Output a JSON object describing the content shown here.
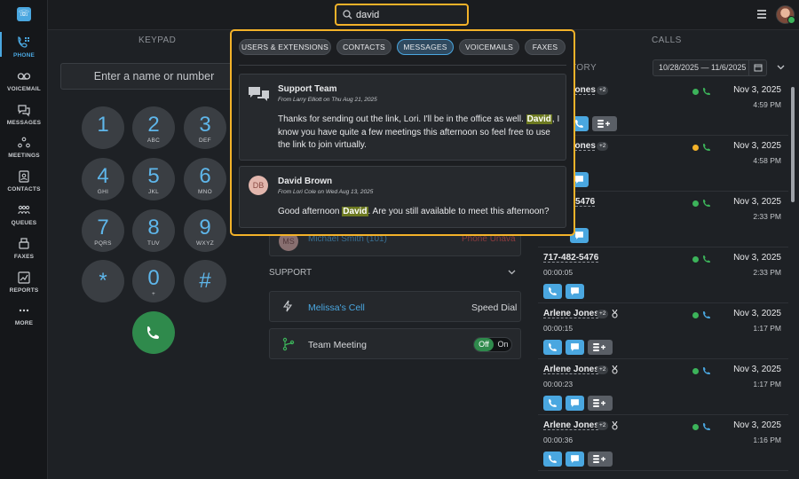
{
  "nav": {
    "items": [
      {
        "label": "PHONE",
        "icon": "phone-dialpad-icon",
        "active": true
      },
      {
        "label": "VOICEMAIL",
        "icon": "voicemail-icon"
      },
      {
        "label": "MESSAGES",
        "icon": "chat-bubbles-icon"
      },
      {
        "label": "MEETINGS",
        "icon": "meetings-icon"
      },
      {
        "label": "CONTACTS",
        "icon": "contacts-icon"
      },
      {
        "label": "QUEUES",
        "icon": "queues-icon"
      },
      {
        "label": "FAXES",
        "icon": "fax-icon"
      },
      {
        "label": "REPORTS",
        "icon": "reports-icon"
      },
      {
        "label": "MORE",
        "icon": "more-dots-icon"
      }
    ]
  },
  "search": {
    "value": "david"
  },
  "keypad": {
    "title": "KEYPAD",
    "placeholder": "Enter a name or number",
    "keys": [
      {
        "n": "1",
        "l": ""
      },
      {
        "n": "2",
        "l": "ABC"
      },
      {
        "n": "3",
        "l": "DEF"
      },
      {
        "n": "4",
        "l": "GHI"
      },
      {
        "n": "5",
        "l": "JKL"
      },
      {
        "n": "6",
        "l": "MNO"
      },
      {
        "n": "7",
        "l": "PQRS"
      },
      {
        "n": "8",
        "l": "TUV"
      },
      {
        "n": "9",
        "l": "WXYZ"
      },
      {
        "n": "*",
        "l": ""
      },
      {
        "n": "0",
        "l": "+"
      },
      {
        "n": "#",
        "l": ""
      }
    ]
  },
  "middle": {
    "hidden_row": {
      "initials": "MS",
      "name": "Michael Smith (101)",
      "status": "Phone Unava"
    },
    "support_title": "SUPPORT",
    "rows": [
      {
        "label": "Melissa's Cell",
        "right": "Speed Dial"
      },
      {
        "label": "Team Meeting",
        "toggle_off": "Off",
        "toggle_on": "On"
      }
    ]
  },
  "calls": {
    "title": "CALLS",
    "history_label": "TORY",
    "date_range": "10/28/2025 — 11/6/2025",
    "items": [
      {
        "who": "Jones",
        "badge": "+2",
        "duration": "",
        "date": "Nov 3, 2025",
        "time": "4:59 PM",
        "status_color": "#3cb35a"
      },
      {
        "who": "Jones",
        "badge": "+2",
        "duration": "",
        "date": "Nov 3, 2025",
        "time": "4:58 PM",
        "status_color": "#f3b229"
      },
      {
        "who": "5476",
        "badge": "",
        "duration": "",
        "date": "Nov 3, 2025",
        "time": "2:33 PM",
        "status_color": "#3cb35a"
      },
      {
        "who": "717-482-5476",
        "badge": "",
        "duration": "00:00:05",
        "date": "Nov 3, 2025",
        "time": "2:33 PM",
        "status_color": "#3cb35a"
      },
      {
        "who": "Arlene Jones",
        "badge": "+2",
        "duration": "00:00:15",
        "date": "Nov 3, 2025",
        "time": "1:17 PM",
        "status_color": "#3cb35a"
      },
      {
        "who": "Arlene Jones",
        "badge": "+2",
        "duration": "00:00:23",
        "date": "Nov 3, 2025",
        "time": "1:17 PM",
        "status_color": "#3cb35a"
      },
      {
        "who": "Arlene Jones",
        "badge": "+2",
        "duration": "00:00:36",
        "date": "Nov 3, 2025",
        "time": "1:16 PM",
        "status_color": "#3cb35a"
      }
    ]
  },
  "results": {
    "tabs": [
      "USERS & EXTENSIONS",
      "CONTACTS",
      "MESSAGES",
      "VOICEMAILS",
      "FAXES"
    ],
    "active_tab": "MESSAGES",
    "items": [
      {
        "title": "Support Team",
        "sub": "From Larry Elliott on Thu Aug 21, 2025",
        "body_pre": "Thanks for sending out the link, Lori. I'll be in the office as well. ",
        "highlight": "David",
        "body_post": ", I know you have quite a few meetings this afternoon so feel free to use the link to join virtually."
      },
      {
        "title": "David Brown",
        "initials": "DB",
        "sub": "From Lori Cole on Wed Aug 13, 2025",
        "body_pre": "Good afternoon ",
        "highlight": "David",
        "body_post": ". Are you still available to meet this afternoon?"
      }
    ]
  },
  "colors": {
    "accent": "#4aa7e0",
    "highlight_border": "#f3b229",
    "call_green": "#2f8a4c"
  }
}
